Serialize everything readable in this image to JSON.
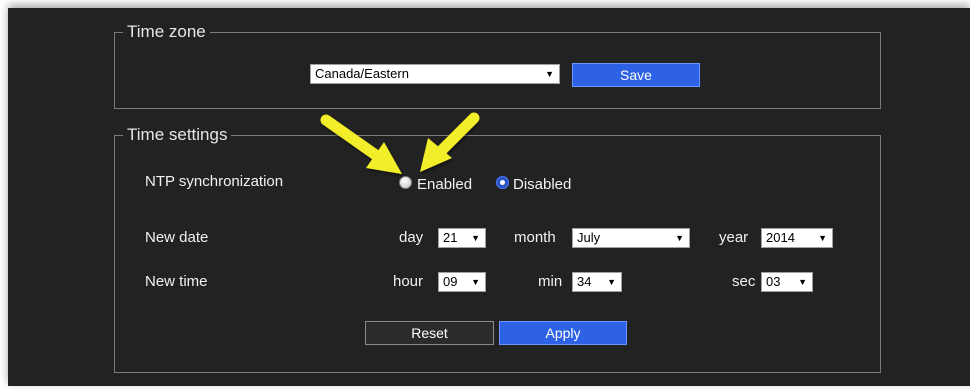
{
  "timezone": {
    "legend": "Time zone",
    "selected": "Canada/Eastern",
    "save_label": "Save"
  },
  "time_settings": {
    "legend": "Time settings",
    "ntp_label": "NTP synchronization",
    "enabled_label": "Enabled",
    "disabled_label": "Disabled",
    "ntp_selected": "Disabled",
    "new_date_label": "New date",
    "day_label": "day",
    "day_value": "21",
    "month_label": "month",
    "month_value": "July",
    "year_label": "year",
    "year_value": "2014",
    "new_time_label": "New time",
    "hour_label": "hour",
    "hour_value": "09",
    "min_label": "min",
    "min_value": "34",
    "sec_label": "sec",
    "sec_value": "03",
    "reset_label": "Reset",
    "apply_label": "Apply"
  },
  "colors": {
    "panel_bg": "#222222",
    "accent_blue": "#2d62e6",
    "annotation_arrow": "#f2ee2a"
  },
  "icons": {
    "dropdown_arrow": "▼",
    "annotation": "yellow-arrow-icon"
  }
}
